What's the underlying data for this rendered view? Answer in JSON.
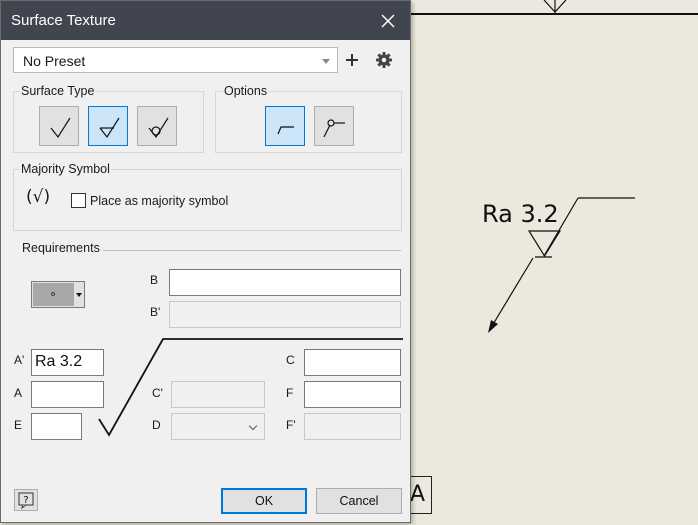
{
  "dialog": {
    "title": "Surface Texture",
    "preset": {
      "value": "No Preset"
    },
    "surface_type": {
      "label": "Surface Type",
      "options": [
        {
          "icon": "basic-surface-icon",
          "selected": false
        },
        {
          "icon": "material-removal-required-icon",
          "selected": true
        },
        {
          "icon": "material-removal-prohibited-icon",
          "selected": false
        }
      ]
    },
    "options": {
      "label": "Options",
      "items": [
        {
          "icon": "leader-direct-icon",
          "selected": true
        },
        {
          "icon": "leader-circle-icon",
          "selected": false
        }
      ]
    },
    "majority": {
      "label": "Majority Symbol",
      "symbol": "(√)",
      "checkbox_label": "Place as majority symbol",
      "checked": false
    },
    "requirements": {
      "label": "Requirements",
      "fields": {
        "B": {
          "label": "B",
          "value": ""
        },
        "B_prime": {
          "label": "B'",
          "value": ""
        },
        "A_prime": {
          "label": "A'",
          "value": "Ra 3.2"
        },
        "A": {
          "label": "A",
          "value": ""
        },
        "E": {
          "label": "E",
          "value": ""
        },
        "C": {
          "label": "C",
          "value": ""
        },
        "C_prime": {
          "label": "C'",
          "value": ""
        },
        "F": {
          "label": "F",
          "value": ""
        },
        "D": {
          "label": "D",
          "value": ""
        },
        "F_prime": {
          "label": "F'",
          "value": ""
        }
      }
    },
    "buttons": {
      "ok": "OK",
      "cancel": "Cancel",
      "help": "?"
    }
  },
  "canvas": {
    "annotation": "Ra 3.2",
    "datum_label": "A"
  }
}
